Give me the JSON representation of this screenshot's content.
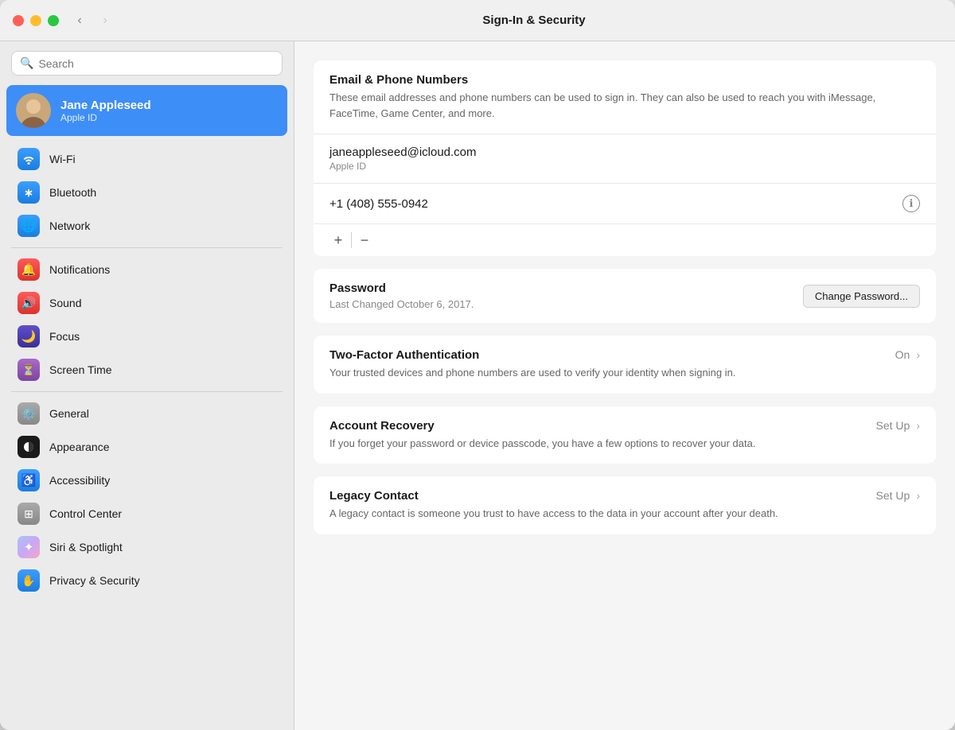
{
  "window": {
    "title": "Sign-In & Security"
  },
  "traffic_lights": {
    "red_label": "close",
    "yellow_label": "minimize",
    "green_label": "maximize"
  },
  "nav": {
    "back_label": "‹",
    "forward_label": "›"
  },
  "sidebar": {
    "search_placeholder": "Search",
    "user": {
      "name": "Jane Appleseed",
      "subtitle": "Apple ID"
    },
    "items": [
      {
        "id": "wifi",
        "label": "Wi-Fi",
        "icon": "📶",
        "icon_class": "icon-wifi"
      },
      {
        "id": "bluetooth",
        "label": "Bluetooth",
        "icon": "✱",
        "icon_class": "icon-bluetooth"
      },
      {
        "id": "network",
        "label": "Network",
        "icon": "🌐",
        "icon_class": "icon-network"
      },
      {
        "id": "notifications",
        "label": "Notifications",
        "icon": "🔔",
        "icon_class": "icon-notifications"
      },
      {
        "id": "sound",
        "label": "Sound",
        "icon": "🔊",
        "icon_class": "icon-sound"
      },
      {
        "id": "focus",
        "label": "Focus",
        "icon": "🌙",
        "icon_class": "icon-focus"
      },
      {
        "id": "screentime",
        "label": "Screen Time",
        "icon": "⏳",
        "icon_class": "icon-screentime"
      },
      {
        "id": "general",
        "label": "General",
        "icon": "⚙️",
        "icon_class": "icon-general"
      },
      {
        "id": "appearance",
        "label": "Appearance",
        "icon": "●",
        "icon_class": "icon-appearance"
      },
      {
        "id": "accessibility",
        "label": "Accessibility",
        "icon": "♿",
        "icon_class": "icon-accessibility"
      },
      {
        "id": "controlcenter",
        "label": "Control Center",
        "icon": "⊞",
        "icon_class": "icon-controlcenter"
      },
      {
        "id": "siri",
        "label": "Siri & Spotlight",
        "icon": "✦",
        "icon_class": "icon-siri"
      },
      {
        "id": "privacy",
        "label": "Privacy & Security",
        "icon": "✋",
        "icon_class": "icon-privacy"
      }
    ]
  },
  "main": {
    "email_section": {
      "title": "Email & Phone Numbers",
      "description": "These email addresses and phone numbers can be used to sign in. They can also be used to reach you with iMessage, FaceTime, Game Center, and more.",
      "email": "janeappleseed@icloud.com",
      "email_type": "Apple ID",
      "phone": "+1 (408) 555-0942",
      "add_label": "+",
      "remove_label": "−"
    },
    "password_section": {
      "title": "Password",
      "last_changed": "Last Changed October 6, 2017.",
      "change_button": "Change Password..."
    },
    "tfa_section": {
      "title": "Two-Factor Authentication",
      "description": "Your trusted devices and phone numbers are used to verify your identity when signing in.",
      "status": "On"
    },
    "account_recovery_section": {
      "title": "Account Recovery",
      "description": "If you forget your password or device passcode, you have a few options to recover your data.",
      "status": "Set Up"
    },
    "legacy_contact_section": {
      "title": "Legacy Contact",
      "description": "A legacy contact is someone you trust to have access to the data in your account after your death.",
      "status": "Set Up"
    }
  }
}
